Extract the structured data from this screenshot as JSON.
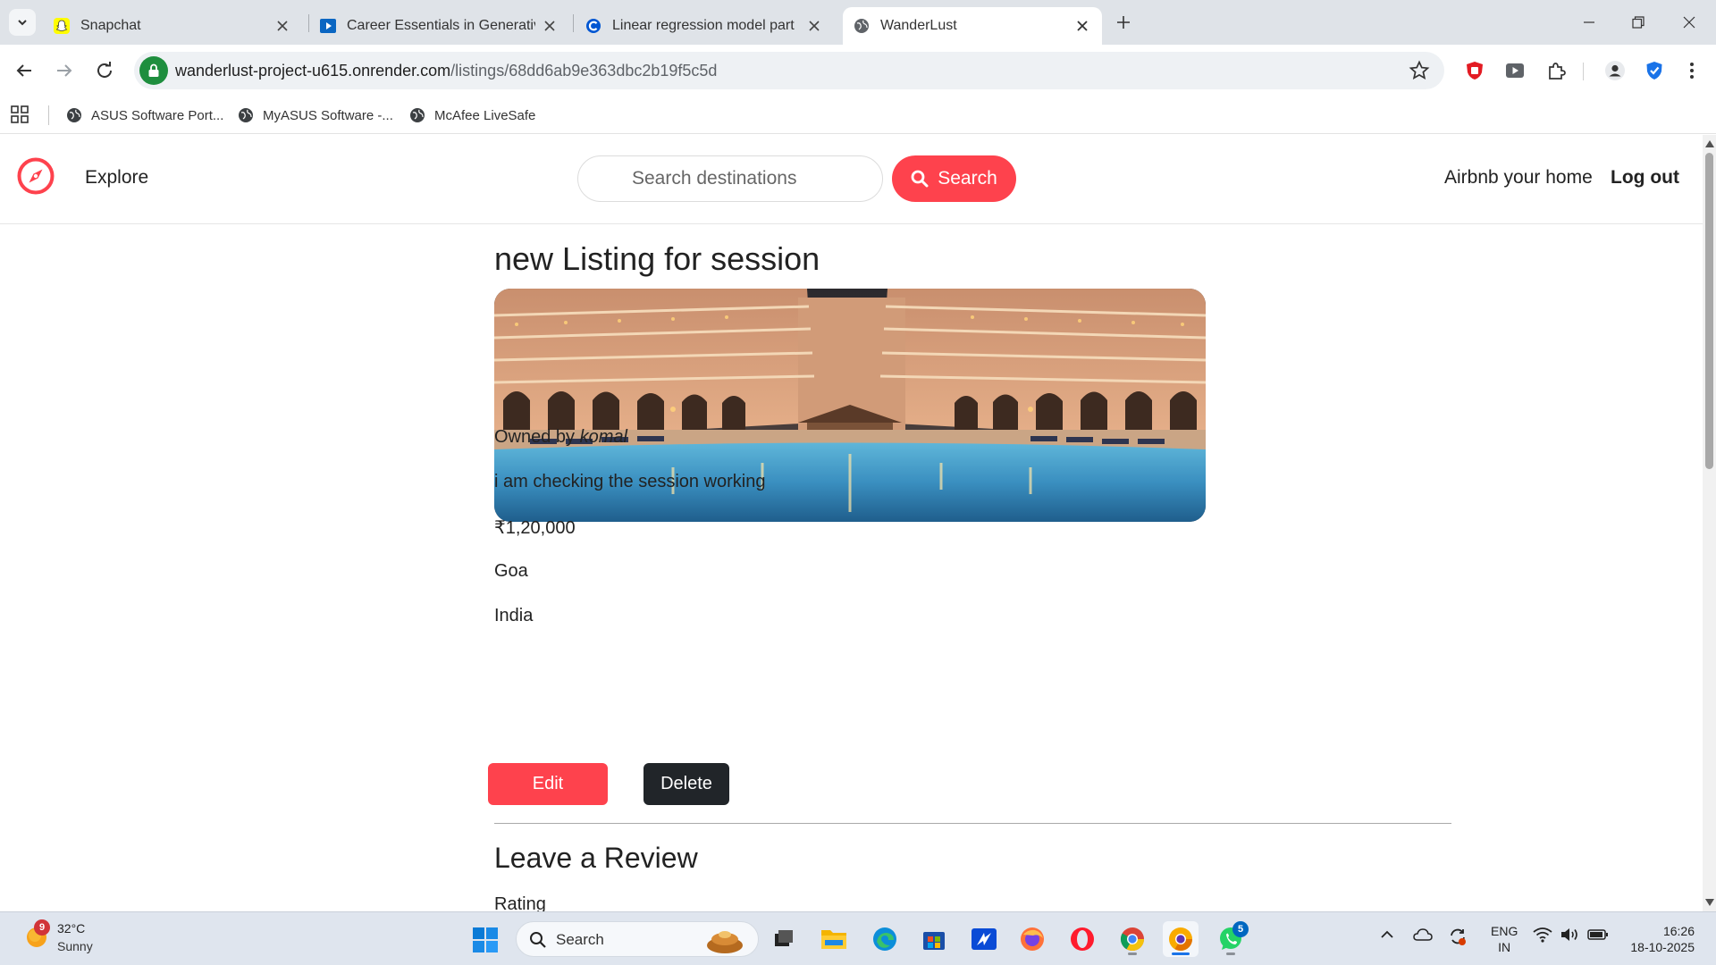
{
  "browser": {
    "tabs": [
      {
        "title": "Snapchat",
        "active": false
      },
      {
        "title": "Career Essentials in Generative AI",
        "active": false
      },
      {
        "title": "Linear regression model part 1",
        "active": false
      },
      {
        "title": "WanderLust",
        "active": true
      }
    ],
    "url": {
      "host": "wanderlust-project-u615.onrender.com",
      "path": "/listings/68dd6ab9e363dbc2b19f5c5d"
    },
    "bookmarks": [
      "ASUS Software Port...",
      "MyASUS Software -...",
      "McAfee LiveSafe"
    ]
  },
  "site_nav": {
    "explore": "Explore",
    "search_placeholder": "Search destinations",
    "search_button": "Search",
    "host_link": "Airbnb your home",
    "logout_link": "Log out"
  },
  "listing": {
    "title": "new Listing for session",
    "owner_prefix": "Owned by",
    "owner": "komal",
    "description": "i am checking the session working",
    "price": "₹1,20,000",
    "location": "Goa",
    "country": "India",
    "edit_label": "Edit",
    "delete_label": "Delete"
  },
  "review": {
    "heading": "Leave a Review",
    "rating_label": "Rating"
  },
  "taskbar": {
    "weather_temp": "32°C",
    "weather_desc": "Sunny",
    "weather_badge": "9",
    "search_label": "Search",
    "whatsapp_badge": "5",
    "lang_line1": "ENG",
    "lang_line2": "IN",
    "time": "16:26",
    "date": "18-10-2025"
  },
  "colors": {
    "brand_red": "#fe424d",
    "dark_button": "#212529",
    "secure_green": "#1e8e3e",
    "taskbar_accent": "#1a73e8"
  }
}
